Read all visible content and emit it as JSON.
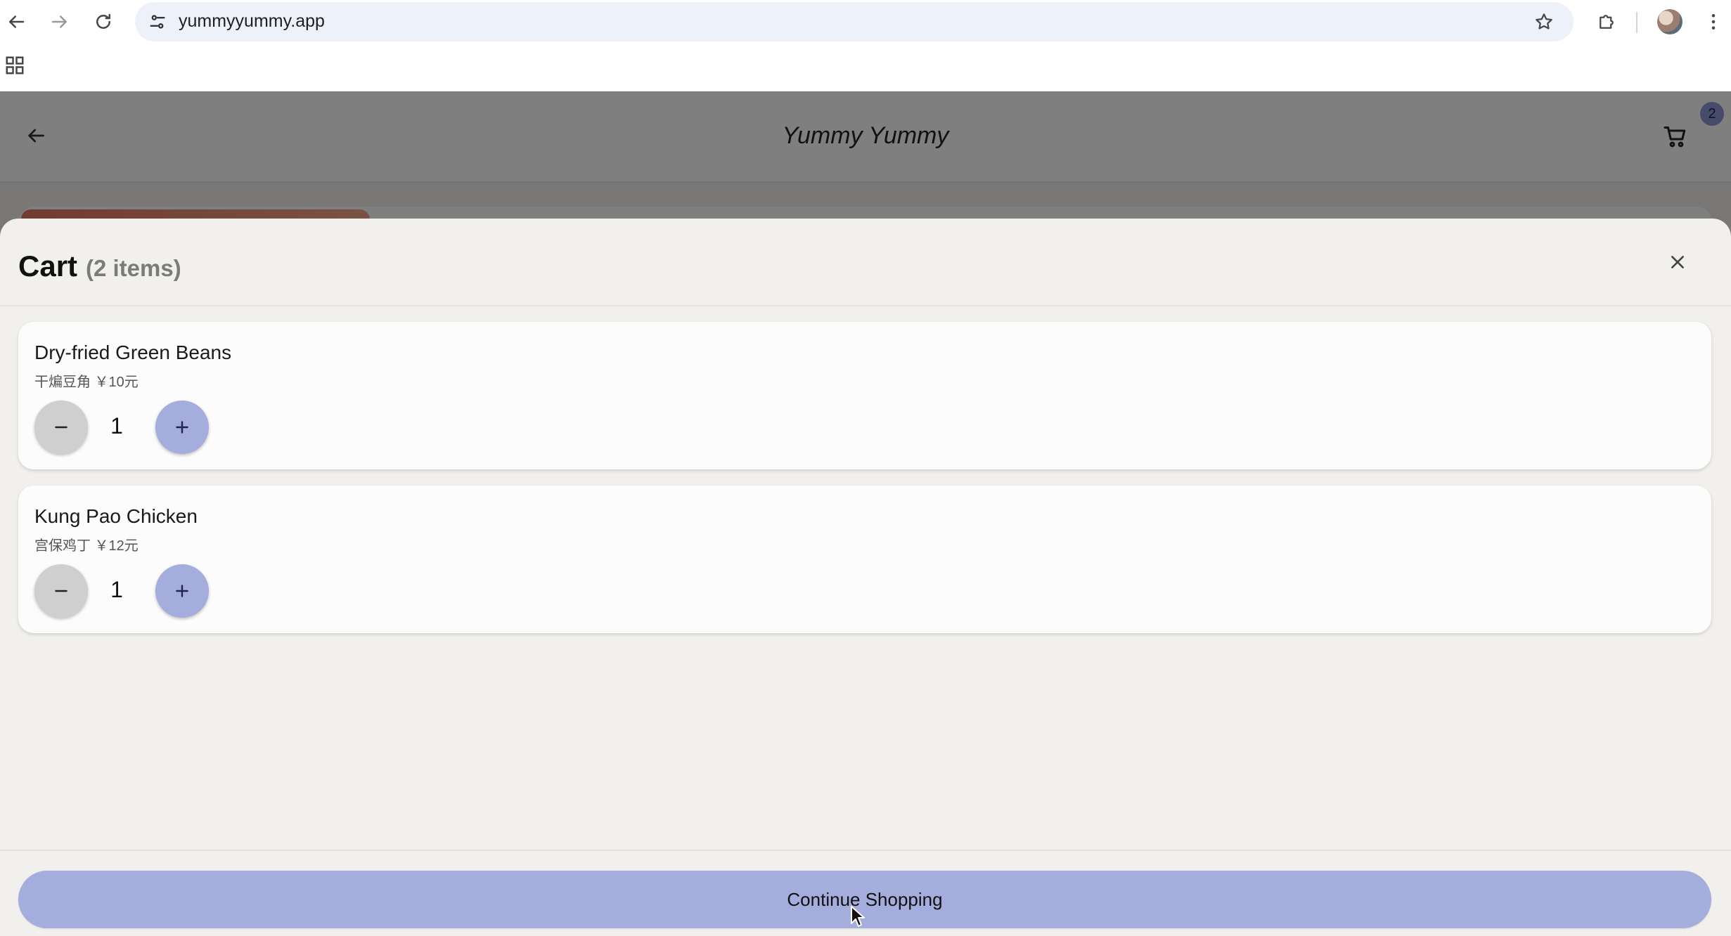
{
  "browser": {
    "url": "yummyyummy.app",
    "icons": {
      "back": "arrow-left-icon",
      "forward": "arrow-right-icon",
      "reload": "reload-icon",
      "site_settings": "tune-icon",
      "bookmark": "star-icon",
      "extensions": "puzzle-icon",
      "profile": "avatar",
      "menu": "kebab-menu-icon",
      "apps": "apps-grid-icon"
    }
  },
  "app": {
    "title": "Yummy Yummy",
    "cart_badge": "2"
  },
  "cart": {
    "title": "Cart",
    "count_label": "(2 items)",
    "items": [
      {
        "name": "Dry-fried Green Beans",
        "subtitle": "干煸豆角 ￥10元",
        "quantity": "1"
      },
      {
        "name": "Kung Pao Chicken",
        "subtitle": "宫保鸡丁 ￥12元",
        "quantity": "1"
      }
    ],
    "continue_label": "Continue Shopping"
  },
  "colors": {
    "accent": "#a4addc",
    "sheet_background": "#f2f0ec",
    "minus_button": "#cfcfcf"
  }
}
